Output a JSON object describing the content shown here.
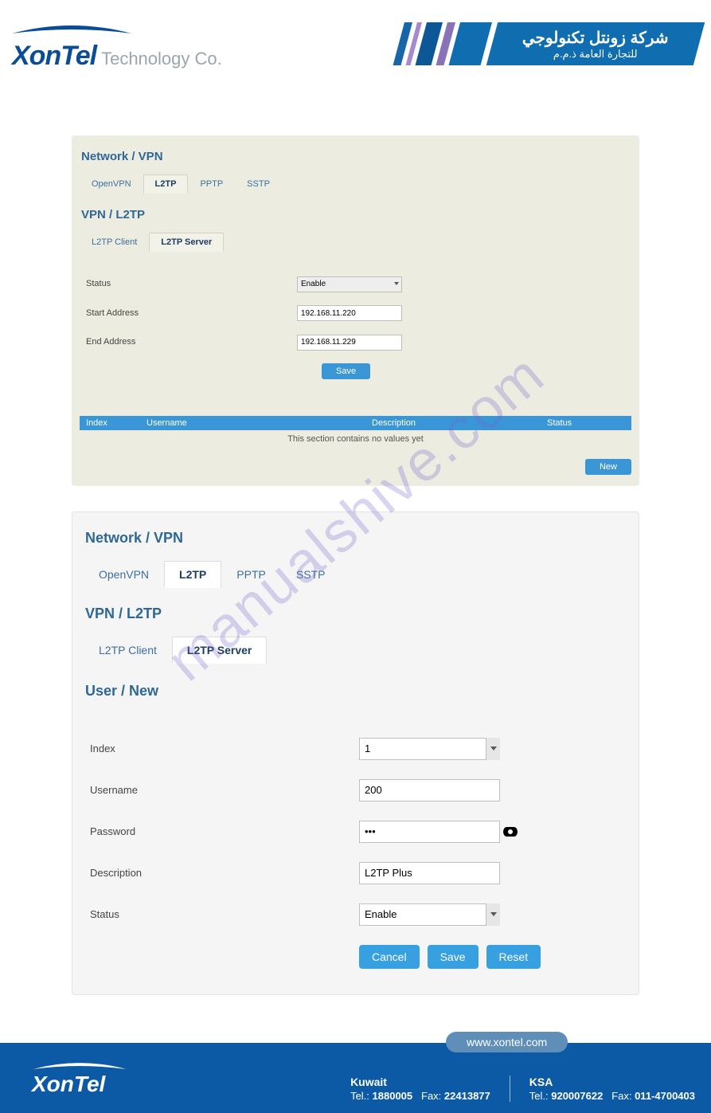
{
  "header": {
    "brand": "XonTel",
    "brand_suffix": "Technology Co.",
    "arabic_line1": "شركة زونتل تكنولوجي",
    "arabic_line2": "للتجارة العامة ذ.م.م"
  },
  "watermark": "manualshive.com",
  "panel1": {
    "title": "Network / VPN",
    "tabs": [
      "OpenVPN",
      "L2TP",
      "PPTP",
      "SSTP"
    ],
    "active_tab": "L2TP",
    "subtitle": "VPN / L2TP",
    "subtabs": [
      "L2TP Client",
      "L2TP Server"
    ],
    "active_subtab": "L2TP Server",
    "fields": {
      "status_label": "Status",
      "status_value": "Enable",
      "start_label": "Start Address",
      "start_value": "192.168.11.220",
      "end_label": "End Address",
      "end_value": "192.168.11.229"
    },
    "save_label": "Save",
    "table": {
      "headers": {
        "index": "Index",
        "username": "Username",
        "description": "Description",
        "status": "Status"
      },
      "empty_text": "This section contains no values yet"
    },
    "new_label": "New"
  },
  "panel2": {
    "title": "Network / VPN",
    "tabs": [
      "OpenVPN",
      "L2TP",
      "PPTP",
      "SSTP"
    ],
    "active_tab": "L2TP",
    "subtitle": "VPN / L2TP",
    "subtabs": [
      "L2TP Client",
      "L2TP Server"
    ],
    "active_subtab": "L2TP Server",
    "section3": "User / New",
    "fields": {
      "index_label": "Index",
      "index_value": "1",
      "username_label": "Username",
      "username_value": "200",
      "password_label": "Password",
      "password_value": "•••",
      "description_label": "Description",
      "description_value": "L2TP Plus",
      "status_label": "Status",
      "status_value": "Enable"
    },
    "buttons": {
      "cancel": "Cancel",
      "save": "Save",
      "reset": "Reset"
    }
  },
  "footer": {
    "url": "www.xontel.com",
    "brand": "XonTel",
    "kuwait": {
      "name": "Kuwait",
      "tel_label": "Tel.:",
      "tel": "1880005",
      "fax_label": "Fax:",
      "fax": "22413877"
    },
    "ksa": {
      "name": "KSA",
      "tel_label": "Tel.:",
      "tel": "920007622",
      "fax_label": "Fax:",
      "fax": "011-4700403"
    }
  }
}
